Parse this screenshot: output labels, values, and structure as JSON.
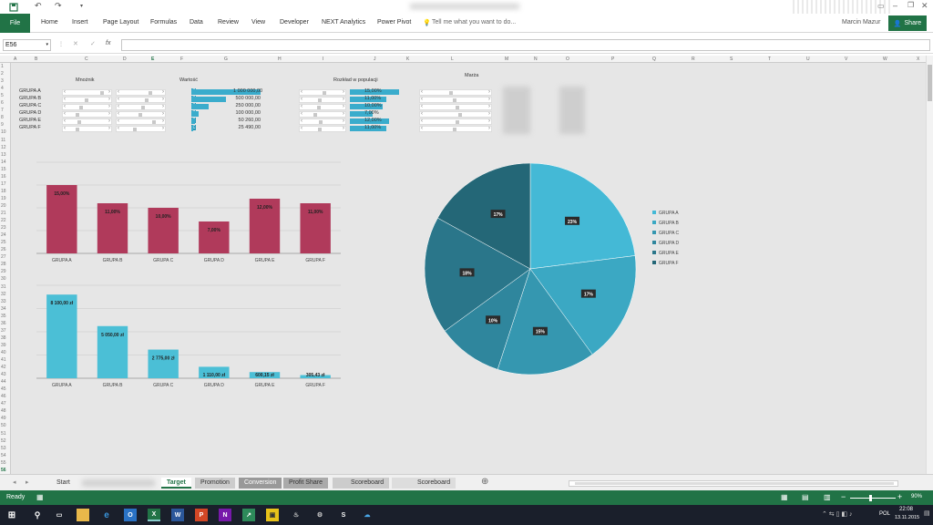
{
  "window": {
    "title_blurred": true,
    "account": "Marcin Mazur"
  },
  "ribbon": {
    "file": "File",
    "tabs": [
      "Home",
      "Insert",
      "Page Layout",
      "Formulas",
      "Data",
      "Review",
      "View",
      "Developer",
      "NEXT Analytics",
      "Power Pivot"
    ],
    "tell_me": "Tell me what you want to do...",
    "share": "Share"
  },
  "formula_bar": {
    "name_box": "E56",
    "fx": "fx",
    "formula": ""
  },
  "columns": [
    "A",
    "B",
    "C",
    "D",
    "E",
    "F",
    "G",
    "H",
    "I",
    "J",
    "K",
    "L",
    "M",
    "N",
    "O",
    "P",
    "Q",
    "R",
    "S",
    "T",
    "U",
    "V",
    "W",
    "X"
  ],
  "sheet": {
    "headers": {
      "mnoznik": "Mnożnik",
      "wartosc": "Wartość",
      "rozklad": "Rozkład w populacji",
      "marza": "Marża"
    },
    "groups": [
      "GRUPA A",
      "GRUPA B",
      "GRUPA C",
      "GRUPA D",
      "GRUPA E",
      "GRUPA F"
    ],
    "currency_symbol": "€",
    "values": [
      "1 000 000,00",
      "500 000,00",
      "250 000,00",
      "100 000,00",
      "50 260,00",
      "25 490,00"
    ],
    "distribution": [
      "15,00%",
      "11,00%",
      "10,00%",
      "7,00%",
      "12,00%",
      "11,00%"
    ]
  },
  "chart_data": [
    {
      "type": "bar",
      "categories": [
        "GRUPA A",
        "GRUPA B",
        "GRUPA C",
        "GRUPA D",
        "GRUPA E",
        "GRUPA F"
      ],
      "values": [
        15,
        11,
        10,
        7,
        12,
        11
      ],
      "data_labels": [
        "15,00%",
        "11,00%",
        "10,00%",
        "7,00%",
        "12,00%",
        "11,00%"
      ],
      "color": "#b03a5b",
      "ylim": [
        0,
        20
      ],
      "grid": true
    },
    {
      "type": "bar",
      "categories": [
        "GRUPA A",
        "GRUPA B",
        "GRUPA C",
        "GRUPA D",
        "GRUPA E",
        "GRUPA F"
      ],
      "values": [
        8100,
        5050,
        2775,
        1110,
        600.15,
        305.43
      ],
      "data_labels": [
        "8 100,00 zł",
        "5 050,00 zł",
        "2 775,00 zł",
        "1 110,00 zł",
        "600,15 zł",
        "305,43 zł"
      ],
      "color": "#4bbfd6",
      "ylim": [
        0,
        9000
      ],
      "grid": true
    },
    {
      "type": "pie",
      "categories": [
        "GRUPA A",
        "GRUPA B",
        "GRUPA C",
        "GRUPA D",
        "GRUPA E",
        "GRUPA F"
      ],
      "values": [
        23,
        17,
        15,
        10,
        18,
        17
      ],
      "data_labels": [
        "23%",
        "17%",
        "15%",
        "10%",
        "18%",
        "17%"
      ],
      "colors": [
        "#44b9d6",
        "#3ba8c3",
        "#3597b0",
        "#2f869d",
        "#2a768a",
        "#246777"
      ],
      "legend": "right"
    }
  ],
  "sheet_tabs": [
    "Start",
    "Target",
    "Promotion",
    "Conversion",
    "Profit Share",
    "Scoreboard",
    "Scoreboard"
  ],
  "active_tab": "Target",
  "status": {
    "ready": "Ready",
    "zoom": "90%"
  },
  "taskbar": {
    "time": "22:08",
    "date": "13.11.2015",
    "lang": "POL"
  }
}
